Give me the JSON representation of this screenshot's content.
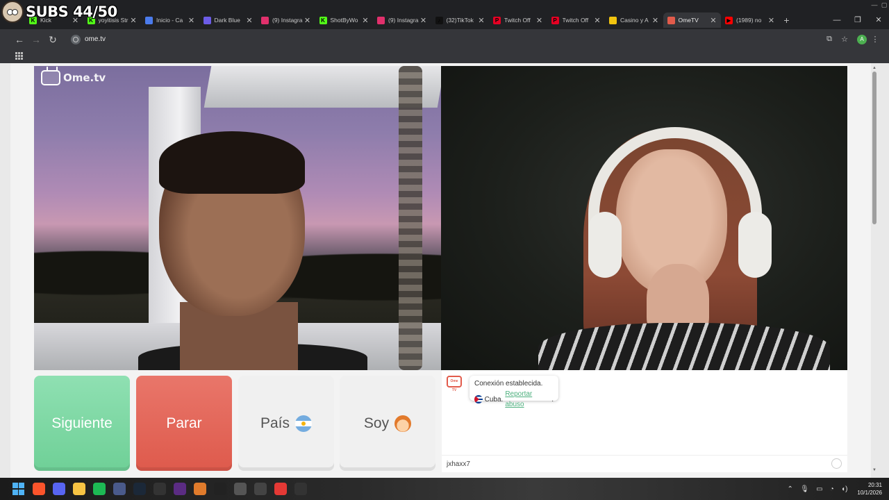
{
  "overlay": {
    "subs_text": "SUBS 44/50"
  },
  "browser": {
    "tabs": [
      {
        "title": "Kick",
        "favicon_color": "#53fc18",
        "favicon_glyph": "K"
      },
      {
        "title": "yoyitisis Str",
        "favicon_color": "#53fc18",
        "favicon_glyph": "K"
      },
      {
        "title": "Inicio - Ca",
        "favicon_color": "#4b7bec",
        "favicon_glyph": ""
      },
      {
        "title": "Dark Blue",
        "favicon_color": "#6c5ce7",
        "favicon_glyph": ""
      },
      {
        "title": "(9) Instagra",
        "favicon_color": "#e1306c",
        "favicon_glyph": ""
      },
      {
        "title": "ShotByWo",
        "favicon_color": "#53fc18",
        "favicon_glyph": "K"
      },
      {
        "title": "(9) Instagra",
        "favicon_color": "#e1306c",
        "favicon_glyph": ""
      },
      {
        "title": "(32)TikTok",
        "favicon_color": "#111111",
        "favicon_glyph": "♪"
      },
      {
        "title": "Twitch Off",
        "favicon_color": "#e60023",
        "favicon_glyph": "P"
      },
      {
        "title": "Twitch Off",
        "favicon_color": "#e60023",
        "favicon_glyph": "P"
      },
      {
        "title": "Casino y A",
        "favicon_color": "#f1c40f",
        "favicon_glyph": ""
      },
      {
        "title": "OmeTV",
        "favicon_color": "#e25b4b",
        "favicon_glyph": "",
        "active": true
      },
      {
        "title": "(1989) no",
        "favicon_color": "#ff0000",
        "favicon_glyph": "▶"
      }
    ],
    "url": "ome.tv"
  },
  "ometv": {
    "logo_text": "Ome.tv",
    "buttons": {
      "next": "Siguiente",
      "stop": "Parar",
      "country": "País",
      "iam": "Soy"
    },
    "chat": {
      "system_logo": "Ome TV",
      "connection_text": "Conexión establecida.",
      "country_text": "Cuba.",
      "report_link": "Reportar abuso",
      "report_suffix": ".",
      "input_value": "jxhaxx7"
    }
  },
  "taskbar": {
    "time": "20:31",
    "date": "10/1/2026",
    "icons": [
      {
        "name": "windows-start-icon",
        "color": "#4fb3f6"
      },
      {
        "name": "brave-icon",
        "color": "#fb542b"
      },
      {
        "name": "discord-icon",
        "color": "#5865f2"
      },
      {
        "name": "file-explorer-icon",
        "color": "#f6c343"
      },
      {
        "name": "spotify-icon",
        "color": "#1db954"
      },
      {
        "name": "app-icon",
        "color": "#4a5a8a"
      },
      {
        "name": "steam-icon",
        "color": "#1b2838"
      },
      {
        "name": "app-icon-2",
        "color": "#333333"
      },
      {
        "name": "app-icon-3",
        "color": "#5b2c83"
      },
      {
        "name": "app-icon-4",
        "color": "#e07b2c"
      },
      {
        "name": "app-icon-5",
        "color": "#222222"
      },
      {
        "name": "app-icon-6",
        "color": "#555555"
      },
      {
        "name": "chatgpt-icon",
        "color": "#444444"
      },
      {
        "name": "youtube-icon",
        "color": "#e53935"
      },
      {
        "name": "obs-icon",
        "color": "#333333"
      }
    ]
  }
}
